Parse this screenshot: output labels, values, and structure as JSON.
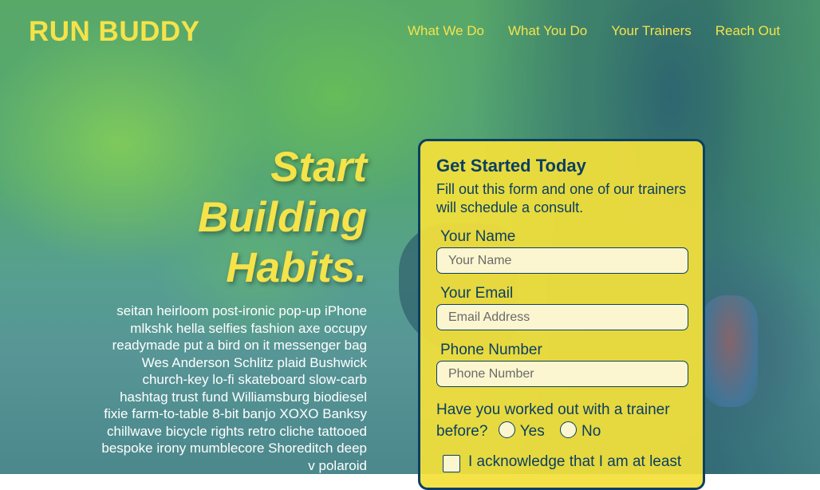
{
  "brand": "RUN BUDDY",
  "nav": [
    {
      "label": "What We Do"
    },
    {
      "label": "What You Do"
    },
    {
      "label": "Your Trainers"
    },
    {
      "label": "Reach Out"
    }
  ],
  "hero": {
    "title_lines": [
      "Start",
      "Building",
      "Habits."
    ],
    "body": "seitan heirloom post-ironic pop-up iPhone mlkshk hella selfies fashion axe occupy readymade put a bird on it messenger bag Wes Anderson Schlitz plaid Bushwick church-key lo-fi skateboard slow-carb hashtag trust fund Williamsburg biodiesel fixie farm-to-table 8-bit banjo XOXO Banksy chillwave bicycle rights retro cliche tattooed bespoke irony mumblecore Shoreditch deep v polaroid"
  },
  "form": {
    "title": "Get Started Today",
    "subtitle": "Fill out this form and one of our trainers will schedule a consult.",
    "name": {
      "label": "Your Name",
      "placeholder": "Your Name"
    },
    "email": {
      "label": "Your Email",
      "placeholder": "Email Address"
    },
    "phone": {
      "label": "Phone Number",
      "placeholder": "Phone Number"
    },
    "question": "Have you worked out with a trainer before?",
    "yes_label": "Yes",
    "no_label": "No",
    "acknowledge": "I acknowledge that I am at least"
  },
  "colors": {
    "accent": "#f5e34a",
    "navy": "#0b3f63"
  }
}
